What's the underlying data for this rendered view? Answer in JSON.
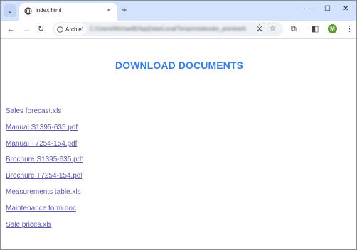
{
  "browser": {
    "tab_title": "index.html",
    "new_tab_glyph": "+",
    "close_tab_glyph": "×",
    "security_chip_label": "Archief",
    "url": "C:/Users/MichaelB/AppData/Local/Temp/notebooks_preview/index.html",
    "profile_initial": "M",
    "icons": [
      "tab-search-icon",
      "globe-icon",
      "back-icon",
      "forward-icon",
      "reload-icon",
      "info-icon",
      "translate-icon",
      "star-icon",
      "extensions-icon",
      "sidepanel-icon",
      "menu-icon",
      "minimize-icon",
      "maximize-icon",
      "close-icon"
    ]
  },
  "page": {
    "heading": "DOWNLOAD DOCUMENTS",
    "links": [
      "Sales forecast.xls",
      "Manual S1395-635.pdf",
      "Manual T7254-154.pdf",
      "Brochure S1395-635.pdf",
      "Brochure T7254-154.pdf",
      "Measurements table.xls",
      "Maintenance form.doc",
      "Sale prices.xls"
    ]
  },
  "colors": {
    "tabstrip": "#d3e3fd",
    "heading": "#3b7ddd",
    "link": "#5b5ba8",
    "avatar": "#5d9b2f"
  }
}
